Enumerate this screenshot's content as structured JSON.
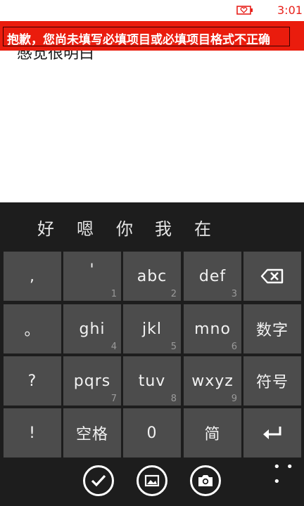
{
  "status_bar": {
    "time": "3:01",
    "battery_icon": "battery-low-heart-icon"
  },
  "error_banner": {
    "message": "抱歉，您尚未填写必填项目或必填项目格式不正确"
  },
  "text_area": {
    "content": "感觉很明白"
  },
  "keyboard": {
    "candidates": [
      "好",
      "嗯",
      "你",
      "我",
      "在"
    ],
    "rows": [
      [
        {
          "label": ",",
          "num": ""
        },
        {
          "label": "'",
          "num": "1"
        },
        {
          "label": "abc",
          "num": "2"
        },
        {
          "label": "def",
          "num": "3"
        },
        {
          "label": "",
          "num": "",
          "icon": "backspace-icon"
        }
      ],
      [
        {
          "label": "。",
          "num": ""
        },
        {
          "label": "ghi",
          "num": "4"
        },
        {
          "label": "jkl",
          "num": "5"
        },
        {
          "label": "mno",
          "num": "6"
        },
        {
          "label": "数字",
          "num": ""
        }
      ],
      [
        {
          "label": "?",
          "num": ""
        },
        {
          "label": "pqrs",
          "num": "7"
        },
        {
          "label": "tuv",
          "num": "8"
        },
        {
          "label": "wxyz",
          "num": "9"
        },
        {
          "label": "符号",
          "num": ""
        }
      ],
      [
        {
          "label": "!",
          "num": ""
        },
        {
          "label": "空格",
          "num": ""
        },
        {
          "label": "0",
          "num": ""
        },
        {
          "label": "简",
          "num": ""
        },
        {
          "label": "",
          "num": "",
          "icon": "enter-icon"
        }
      ]
    ]
  },
  "app_bar": {
    "buttons": [
      "checkmark-icon",
      "image-icon",
      "camera-icon"
    ],
    "more": "• • •"
  },
  "colors": {
    "accent": "#e8201a",
    "banner": "#ea1c0d",
    "key": "#4c4c4c",
    "keyboard_bg": "#1d1d1d"
  }
}
